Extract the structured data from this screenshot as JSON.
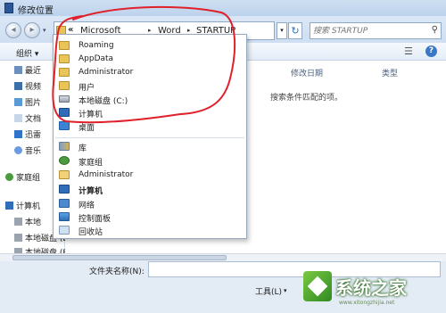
{
  "window": {
    "title": "修改位置"
  },
  "nav": {
    "back_icon": "back-arrow-icon",
    "forward_icon": "forward-arrow-icon",
    "address": {
      "overflow_glyph": "«",
      "crumbs": [
        "Microsoft",
        "Word",
        "STARTUP"
      ],
      "separator_glyph": "▸"
    },
    "refresh_glyph": "↻",
    "search_placeholder": "搜索 STARTUP"
  },
  "toolbar": {
    "organize_label": "组织 ▾",
    "view_glyph": "☰",
    "help_glyph": "?"
  },
  "sidebar": {
    "items": [
      {
        "label": "最近",
        "icon": "recent-places-icon"
      },
      {
        "label": "视频",
        "icon": "videos-icon"
      },
      {
        "label": "图片",
        "icon": "pictures-icon"
      },
      {
        "label": "文档",
        "icon": "documents-icon"
      },
      {
        "label": "迅雷",
        "icon": "thunder-icon"
      },
      {
        "label": "音乐",
        "icon": "music-icon"
      },
      {
        "label": "家庭组",
        "icon": "homegroup-icon"
      },
      {
        "label": "计算机",
        "icon": "computer-icon"
      },
      {
        "label": "本地",
        "icon": "local-disk-icon"
      },
      {
        "label": "本地磁盘 (D:)",
        "icon": "local-disk-icon"
      },
      {
        "label": "本地磁盘 (E:)",
        "icon": "local-disk-icon"
      }
    ]
  },
  "content": {
    "columns": {
      "date_modified": "修改日期",
      "type": "类型"
    },
    "empty_message": "搜索条件匹配的项。"
  },
  "dropdown": {
    "items": [
      {
        "label": "Roaming",
        "icon": "folder-icon",
        "bold": false
      },
      {
        "label": "AppData",
        "icon": "folder-icon",
        "bold": false
      },
      {
        "label": "Administrator",
        "icon": "folder-icon",
        "bold": false
      },
      {
        "label": "用户",
        "icon": "folder-icon",
        "bold": false
      },
      {
        "label": "本地磁盘 (C:)",
        "icon": "local-disk-icon",
        "bold": false
      },
      {
        "label": "计算机",
        "icon": "computer-icon",
        "bold": false
      },
      {
        "label": "桌面",
        "icon": "desktop-icon",
        "bold": false
      },
      {
        "label": "库",
        "icon": "libraries-icon",
        "bold": false
      },
      {
        "label": "家庭组",
        "icon": "homegroup-icon",
        "bold": false
      },
      {
        "label": "Administrator",
        "icon": "user-folder-icon",
        "bold": false
      },
      {
        "label": "计算机",
        "icon": "computer-icon",
        "bold": true
      },
      {
        "label": "网络",
        "icon": "network-icon",
        "bold": false
      },
      {
        "label": "控制面板",
        "icon": "control-panel-icon",
        "bold": false
      },
      {
        "label": "回收站",
        "icon": "recycle-bin-icon",
        "bold": false
      }
    ]
  },
  "bottom": {
    "folder_name_label": "文件夹名称(N):",
    "folder_name_value": "",
    "tools_label": "工具(L)",
    "tools_arrow": "▾"
  },
  "watermark": {
    "text": "系统之家",
    "url": "www.xitongzhijia.net"
  },
  "colors": {
    "annotation_red": "#e0202a",
    "window_frame": "#cfdff2"
  }
}
